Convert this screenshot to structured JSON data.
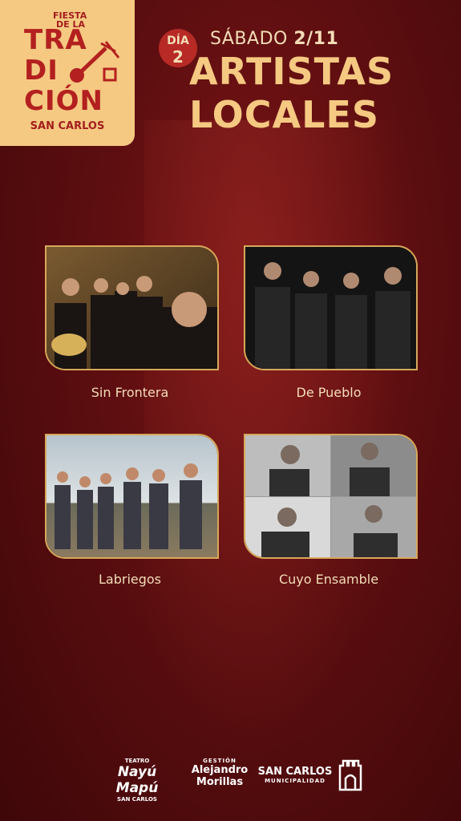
{
  "logo": {
    "line1": "FIESTA",
    "line2": "DE LA",
    "big1": "TRA",
    "big2": "DI",
    "big3": "CIÓN",
    "sub": "SAN CARLOS"
  },
  "header": {
    "dia_label": "DÍA",
    "dia_number": "2",
    "day": "SÁBADO",
    "date": "2/11",
    "title_line1": "ARTISTAS",
    "title_line2": "LOCALES"
  },
  "artists": [
    {
      "name": "Sin Frontera"
    },
    {
      "name": "De Pueblo"
    },
    {
      "name": "Labriegos"
    },
    {
      "name": "Cuyo Ensamble"
    }
  ],
  "footer": {
    "teatro_small": "TEATRO",
    "teatro_name": "Nayú Mapú",
    "teatro_sub": "SAN CARLOS",
    "gestion_small": "GESTIÓN",
    "gestion_line1": "Alejandro",
    "gestion_line2": "Morillas",
    "muni_name": "SAN CARLOS",
    "muni_sub": "MUNICIPALIDAD"
  },
  "colors": {
    "background": "#5c0e10",
    "accent": "#f5c982",
    "brand_red": "#b3201f",
    "text": "#f3ddb8"
  }
}
